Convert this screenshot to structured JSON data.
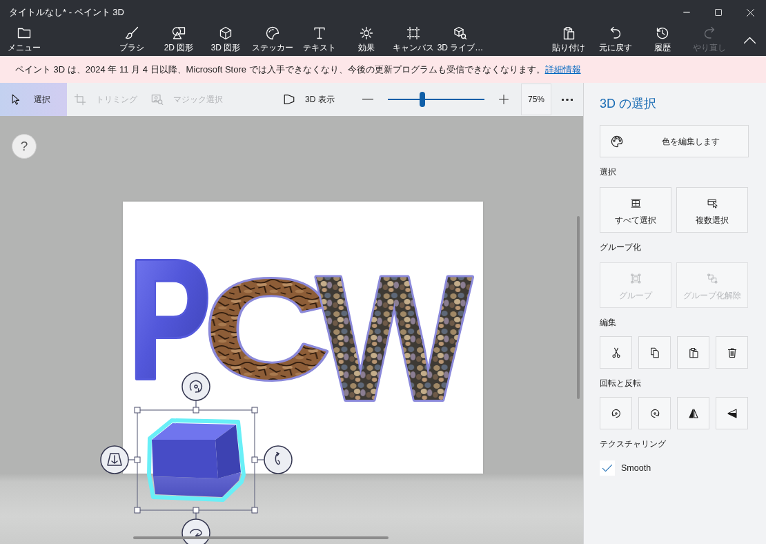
{
  "window": {
    "title": "タイトルなし* - ペイント 3D"
  },
  "ribbon": {
    "menu": {
      "label": "メニュー"
    },
    "tools": [
      {
        "kind": "brush",
        "label": "ブラシ"
      },
      {
        "kind": "shapes2d",
        "label": "2D 図形"
      },
      {
        "kind": "shapes3d",
        "label": "3D 図形"
      },
      {
        "kind": "stickers",
        "label": "ステッカー"
      },
      {
        "kind": "text",
        "label": "テキスト"
      },
      {
        "kind": "effects",
        "label": "効果"
      },
      {
        "kind": "canvas",
        "label": "キャンバス"
      },
      {
        "kind": "library",
        "label": "3D ライブ…"
      }
    ],
    "actions": [
      {
        "kind": "paste",
        "label": "貼り付け",
        "disabled": false
      },
      {
        "kind": "undo",
        "label": "元に戻す",
        "disabled": false
      },
      {
        "kind": "history",
        "label": "履歴",
        "disabled": false
      },
      {
        "kind": "redo",
        "label": "やり直し",
        "disabled": true
      }
    ]
  },
  "notice": {
    "text": "ペイント 3D は、2024 年 11 月 4 日以降、Microsoft Store では入手できなくなり、今後の更新プログラムも受信できなくなります。",
    "link": "詳細情報"
  },
  "toolbar": {
    "select_tools": [
      {
        "kind": "select",
        "label": "選択",
        "selected": true,
        "disabled": false
      },
      {
        "kind": "crop",
        "label": "トリミング",
        "selected": false,
        "disabled": true
      },
      {
        "kind": "magic",
        "label": "マジック選択",
        "selected": false,
        "disabled": true
      }
    ],
    "view_3d": {
      "label": "3D 表示"
    },
    "zoom": {
      "level": 0.36,
      "reading": "75%"
    }
  },
  "canvas": {
    "help": "?",
    "letters": [
      {
        "kind": "tube",
        "text": "P"
      },
      {
        "kind": "bark",
        "text": "C"
      },
      {
        "kind": "pebble",
        "text": "W"
      }
    ],
    "cube": {
      "selected": true
    }
  },
  "panel": {
    "title": "3D の選択",
    "edit_color": {
      "label": "色を編集します"
    },
    "sections": [
      {
        "kind": "wide",
        "title": "選択",
        "buttons": [
          {
            "kind": "select-all",
            "label": "すべて選択",
            "disabled": false
          },
          {
            "kind": "multi",
            "label": "複数選択",
            "disabled": false
          }
        ]
      },
      {
        "kind": "wide",
        "title": "グループ化",
        "buttons": [
          {
            "kind": "group",
            "label": "グループ",
            "disabled": true
          },
          {
            "kind": "ungroup",
            "label": "グループ化解除",
            "disabled": true
          }
        ]
      },
      {
        "kind": "icons",
        "title": "編集",
        "buttons": [
          {
            "kind": "cut"
          },
          {
            "kind": "copy"
          },
          {
            "kind": "paste"
          },
          {
            "kind": "delete"
          }
        ]
      },
      {
        "kind": "icons",
        "title": "回転と反転",
        "buttons": [
          {
            "kind": "rotate-left"
          },
          {
            "kind": "rotate-right"
          },
          {
            "kind": "flip-h"
          },
          {
            "kind": "flip-v"
          }
        ]
      },
      {
        "kind": "checkbox",
        "title": "テクスチャリング",
        "checkbox": {
          "label": "Smooth",
          "checked": true
        }
      }
    ]
  }
}
